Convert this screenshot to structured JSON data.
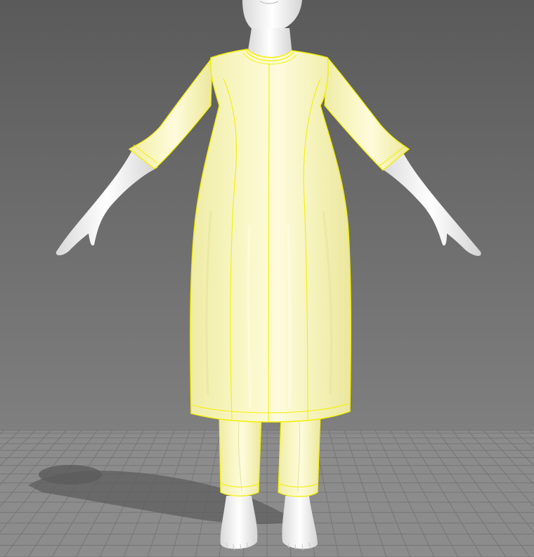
{
  "viewport": {
    "background_top": "#5c5c5c",
    "background_bottom": "#8a8a8a",
    "floor_color": "#8c8c8c",
    "floor_grid_color": "#767676",
    "shadow_color": "#5a5a5a",
    "skin_color": "#eeeeee",
    "garment_fill": "#f6f3b4",
    "garment_highlight": "#fbf9d6",
    "selection_outline": "#f4f000"
  },
  "objects": {
    "avatar": "avatar-figure",
    "garments": [
      "kurta-dress",
      "trousers"
    ],
    "selected": true
  }
}
